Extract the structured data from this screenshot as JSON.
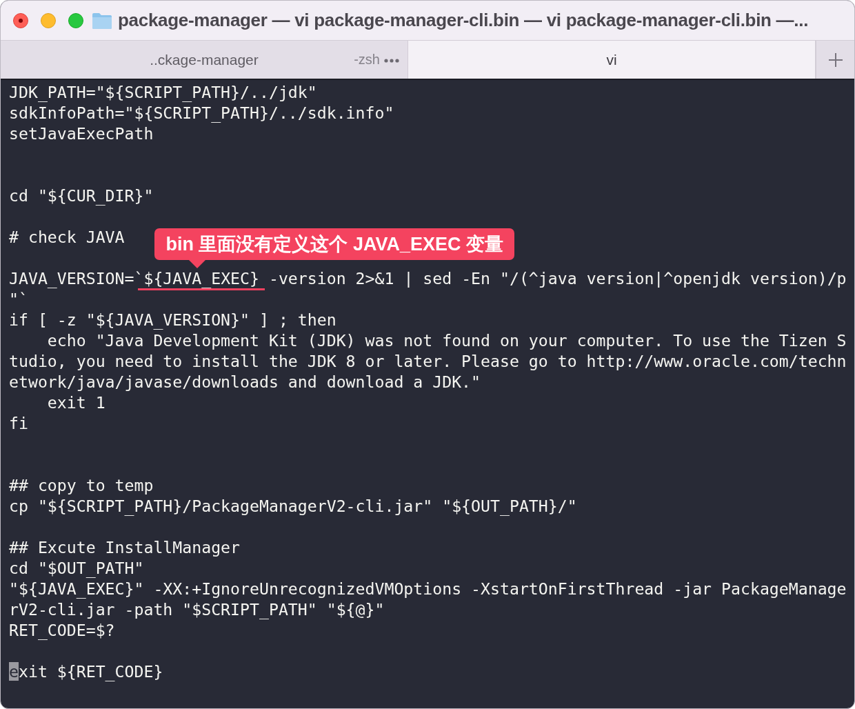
{
  "window": {
    "title": "package-manager — vi package-manager-cli.bin — vi package-manager-cli.bin —..."
  },
  "tabs": [
    {
      "label": "..ckage-manager",
      "process": "-zsh",
      "selected": false
    },
    {
      "label": "vi",
      "selected": true
    }
  ],
  "terminal": {
    "rows": [
      {
        "kind": "line",
        "text": "JDK_PATH=\"${SCRIPT_PATH}/../jdk\""
      },
      {
        "kind": "line",
        "text": "sdkInfoPath=\"${SCRIPT_PATH}/../sdk.info\""
      },
      {
        "kind": "line",
        "text": "setJavaExecPath"
      },
      {
        "kind": "blank"
      },
      {
        "kind": "blank"
      },
      {
        "kind": "line",
        "text": "cd \"${CUR_DIR}\""
      },
      {
        "kind": "blank"
      },
      {
        "kind": "line",
        "text": "# check JAVA"
      },
      {
        "kind": "blank"
      },
      {
        "kind": "annotated",
        "before": "JAVA_VERSION=`",
        "marked": "${JAVA_EXEC}",
        "after": " -version 2>&1 | sed -En \"/(^java version|^openjdk version)/p",
        "callout": "bin 里面没有定义这个 JAVA_EXEC 变量"
      },
      {
        "kind": "line",
        "text": "\"`"
      },
      {
        "kind": "line",
        "text": "if [ -z \"${JAVA_VERSION}\" ] ; then"
      },
      {
        "kind": "line",
        "text": "    echo \"Java Development Kit (JDK) was not found on your computer. To use the Tizen S"
      },
      {
        "kind": "line",
        "text": "tudio, you need to install the JDK 8 or later. Please go to http://www.oracle.com/techn"
      },
      {
        "kind": "line",
        "text": "etwork/java/javase/downloads and download a JDK.\""
      },
      {
        "kind": "line",
        "text": "    exit 1"
      },
      {
        "kind": "line",
        "text": "fi"
      },
      {
        "kind": "blank"
      },
      {
        "kind": "blank"
      },
      {
        "kind": "line",
        "text": "## copy to temp"
      },
      {
        "kind": "line",
        "text": "cp \"${SCRIPT_PATH}/PackageManagerV2-cli.jar\" \"${OUT_PATH}/\""
      },
      {
        "kind": "blank"
      },
      {
        "kind": "line",
        "text": "## Excute InstallManager"
      },
      {
        "kind": "line",
        "text": "cd \"$OUT_PATH\""
      },
      {
        "kind": "line",
        "text": "\"${JAVA_EXEC}\" -XX:+IgnoreUnrecognizedVMOptions -XstartOnFirstThread -jar PackageManage"
      },
      {
        "kind": "line",
        "text": "rV2-cli.jar -path \"$SCRIPT_PATH\" \"${@}\""
      },
      {
        "kind": "line",
        "text": "RET_CODE=$?"
      },
      {
        "kind": "blank"
      },
      {
        "kind": "cursor",
        "cursor_char": "e",
        "text": "xit ${RET_CODE}"
      }
    ]
  }
}
